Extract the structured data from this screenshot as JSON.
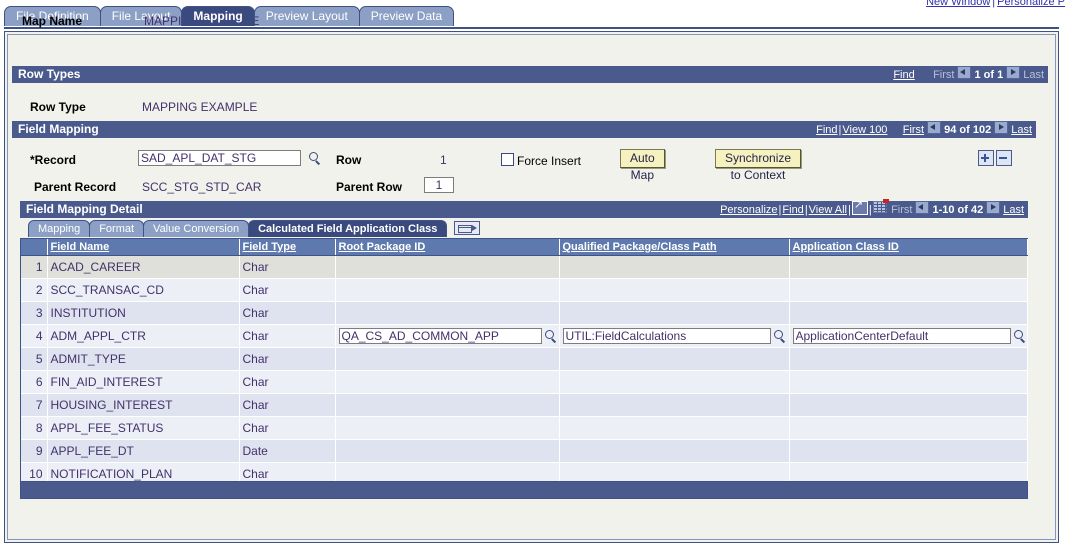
{
  "toplinks": {
    "new_window": "New Window",
    "separator": "|",
    "personalize": "Personalize P"
  },
  "tabs": [
    {
      "label": "File Definition",
      "active": false
    },
    {
      "label": "File Layout",
      "active": false
    },
    {
      "label": "Mapping",
      "active": true
    },
    {
      "label": "Preview Layout",
      "active": false
    },
    {
      "label": "Preview Data",
      "active": false
    }
  ],
  "map": {
    "name_label": "Map Name",
    "name_value": "MAPPING EXAMPLE"
  },
  "row_types": {
    "title": "Row Types",
    "find": "Find",
    "first": "First",
    "counter": "1 of 1",
    "last": "Last",
    "row_type_label": "Row Type",
    "row_type_value": "MAPPING EXAMPLE"
  },
  "field_mapping": {
    "title": "Field Mapping",
    "find": "Find",
    "view100": "View 100",
    "first": "First",
    "counter": "94 of 102",
    "last": "Last",
    "record_label": "*Record",
    "record_value": "SAD_APL_DAT_STG",
    "parent_record_label": "Parent Record",
    "parent_record_value": "SCC_STG_STD_CAR",
    "row_label": "Row",
    "row_value": "1",
    "parent_row_label": "Parent Row",
    "parent_row_value": "1",
    "force_insert_label": "Force Insert",
    "force_insert_checked": false,
    "auto_map_button": "Auto Map",
    "sync_button": "Synchronize to Context"
  },
  "field_mapping_detail": {
    "title": "Field Mapping Detail",
    "personalize": "Personalize",
    "find": "Find",
    "view_all": "View All",
    "expand_icon": "expand-icon",
    "grid_icon": "spreadsheet-icon",
    "first": "First",
    "counter": "1-10 of 42",
    "last": "Last",
    "subtabs": [
      {
        "label": "Mapping",
        "active": false
      },
      {
        "label": "Format",
        "active": false
      },
      {
        "label": "Value Conversion",
        "active": false
      },
      {
        "label": "Calculated Field Application Class",
        "active": true
      }
    ],
    "next_tabs_icon": "next-tabs-icon",
    "columns": [
      "",
      "Field Name",
      "Field Type",
      "Root Package ID",
      "Qualified Package/Class Path",
      "Application Class ID"
    ],
    "rows": [
      {
        "num": "1",
        "field_name": "ACAD_CAREER",
        "field_type": "Char",
        "root_package_id": "",
        "qualified_path": "",
        "app_class_id": ""
      },
      {
        "num": "2",
        "field_name": "SCC_TRANSAC_CD",
        "field_type": "Char",
        "root_package_id": "",
        "qualified_path": "",
        "app_class_id": ""
      },
      {
        "num": "3",
        "field_name": "INSTITUTION",
        "field_type": "Char",
        "root_package_id": "",
        "qualified_path": "",
        "app_class_id": ""
      },
      {
        "num": "4",
        "field_name": "ADM_APPL_CTR",
        "field_type": "Char",
        "root_package_id": "QA_CS_AD_COMMON_APP",
        "qualified_path": "UTIL:FieldCalculations",
        "app_class_id": "ApplicationCenterDefault"
      },
      {
        "num": "5",
        "field_name": "ADMIT_TYPE",
        "field_type": "Char",
        "root_package_id": "",
        "qualified_path": "",
        "app_class_id": ""
      },
      {
        "num": "6",
        "field_name": "FIN_AID_INTEREST",
        "field_type": "Char",
        "root_package_id": "",
        "qualified_path": "",
        "app_class_id": ""
      },
      {
        "num": "7",
        "field_name": "HOUSING_INTEREST",
        "field_type": "Char",
        "root_package_id": "",
        "qualified_path": "",
        "app_class_id": ""
      },
      {
        "num": "8",
        "field_name": "APPL_FEE_STATUS",
        "field_type": "Char",
        "root_package_id": "",
        "qualified_path": "",
        "app_class_id": ""
      },
      {
        "num": "9",
        "field_name": "APPL_FEE_DT",
        "field_type": "Date",
        "root_package_id": "",
        "qualified_path": "",
        "app_class_id": ""
      },
      {
        "num": "10",
        "field_name": "NOTIFICATION_PLAN",
        "field_type": "Char",
        "root_package_id": "",
        "qualified_path": "",
        "app_class_id": ""
      }
    ]
  },
  "colors": {
    "header_bar": "#4a5a8c",
    "active_tab": "#3b4a7e",
    "inactive_tab": "#8c9fc5",
    "column_header": "#5e79ad",
    "button": "#f5f2c0",
    "page_bg": "#f2f2ec"
  }
}
